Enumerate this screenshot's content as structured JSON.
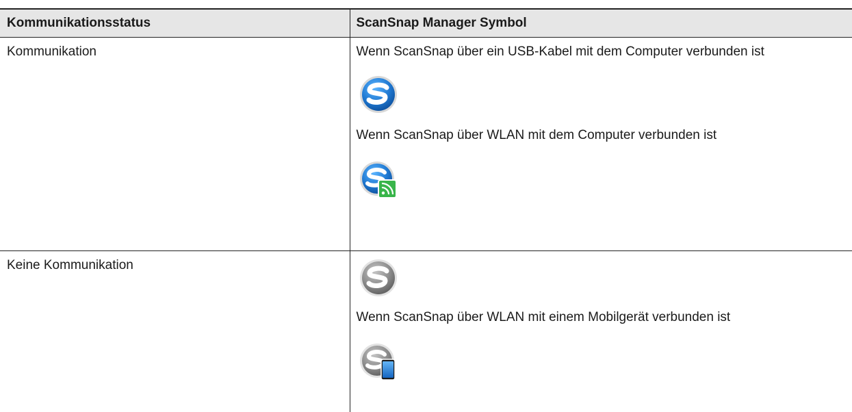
{
  "table": {
    "headers": {
      "status": "Kommunikationsstatus",
      "symbol": "ScanSnap Manager Symbol"
    },
    "rows": [
      {
        "status": "Kommunikation",
        "entries": [
          {
            "text": "Wenn ScanSnap über ein USB-Kabel mit dem Computer verbunden ist",
            "icon": "scansnap-blue-icon"
          },
          {
            "text": "Wenn ScanSnap über WLAN mit dem Computer verbunden ist",
            "icon": "scansnap-blue-wifi-icon"
          }
        ]
      },
      {
        "status": "Keine Kommunikation",
        "entries": [
          {
            "text": "",
            "icon": "scansnap-gray-icon"
          },
          {
            "text": "Wenn ScanSnap über WLAN mit einem Mobilgerät verbunden ist",
            "icon": "scansnap-gray-mobile-icon"
          }
        ]
      }
    ]
  },
  "colors": {
    "header_bg": "#e6e6e6",
    "border": "#222222",
    "icon_blue": "#1f78d1",
    "icon_gray": "#8c8c8c",
    "wifi_green": "#39b54a",
    "mobile_blue": "#1e88e5"
  }
}
